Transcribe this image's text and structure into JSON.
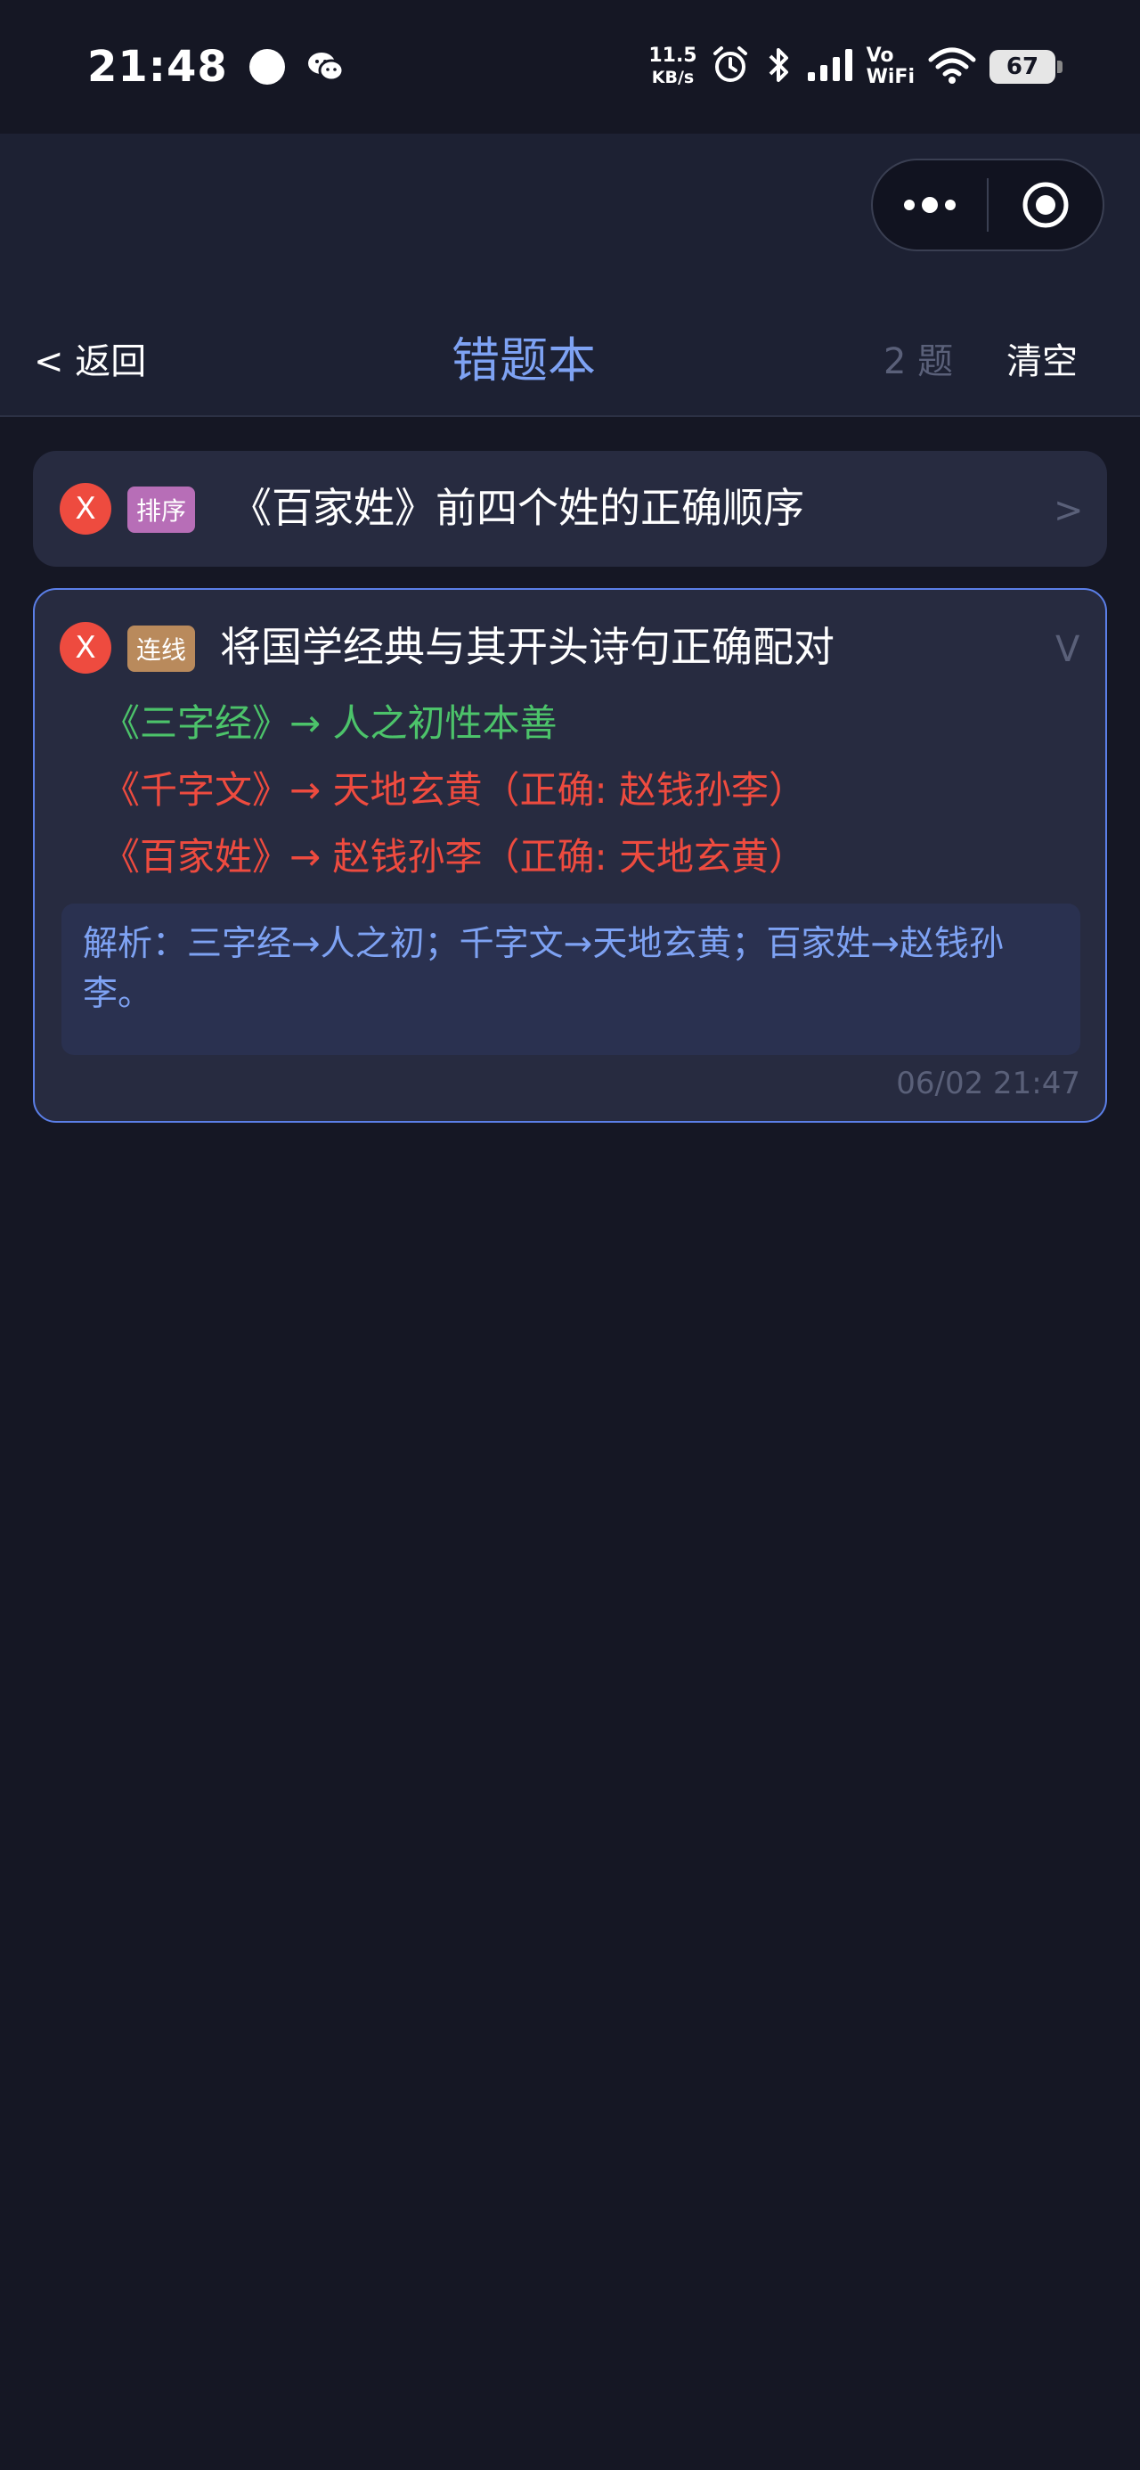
{
  "status_bar": {
    "time": "21:48",
    "net_speed_value": "11.5",
    "net_speed_unit": "KB/s",
    "vowifi_top": "Vo",
    "vowifi_bottom": "WiFi",
    "battery": "67",
    "icons": [
      "circle-dot-icon",
      "wechat-icon",
      "alarm-icon",
      "bluetooth-icon",
      "signal-icon",
      "wifi-icon",
      "battery-icon"
    ]
  },
  "capsule": {
    "icons": [
      "more-dots-icon",
      "target-icon"
    ]
  },
  "header": {
    "back_label": "< 返回",
    "title": "错题本",
    "count_label": "2 题",
    "clear_label": "清空"
  },
  "items": [
    {
      "badge": "X",
      "tag": "排序",
      "title": "《百家姓》前四个姓的正确顺序",
      "chevron": ">"
    },
    {
      "badge": "X",
      "tag": "连线",
      "title": "将国学经典与其开头诗句正确配对",
      "chevron": "V",
      "pairs": [
        "《三字经》→ 人之初性本善",
        "《千字文》→ 天地玄黄（正确: 赵钱孙李）",
        "《百家姓》→ 赵钱孙李（正确: 天地玄黄）"
      ],
      "explanation": "解析：三字经→人之初；千字文→天地玄黄；百家姓→赵钱孙李。",
      "timestamp": "06/02 21:47"
    }
  ],
  "colors": {
    "background": "#151724",
    "card": "#272b40",
    "accent": "#7ea2f3",
    "correct": "#4cc36a",
    "wrong": "#ee4b3f",
    "tag_sort": "#b76eb7",
    "tag_match": "#b98a5c"
  }
}
